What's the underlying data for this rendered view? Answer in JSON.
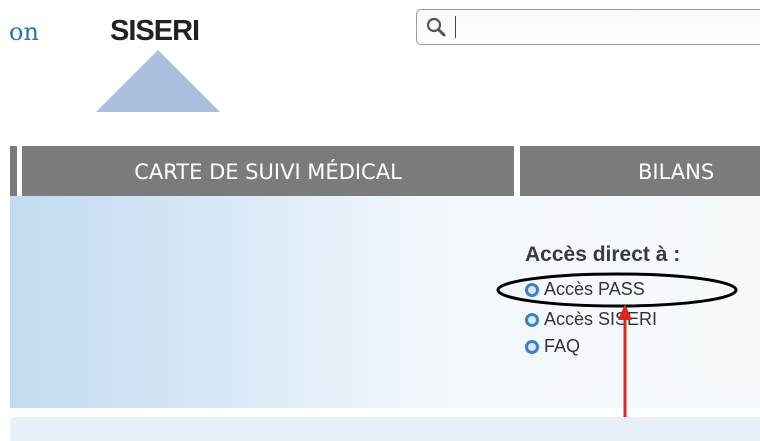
{
  "header": {
    "brand_fragment": "on",
    "logo_text": "SISERI",
    "logo_color": "#a9bfde",
    "search": {
      "value": "",
      "placeholder": ""
    }
  },
  "nav": {
    "items": [
      {
        "label": "CARTE DE SUIVI MÉDICAL"
      },
      {
        "label": "BILANS"
      }
    ],
    "bar_color": "#7b7b7b"
  },
  "direct_access": {
    "title": "Accès direct à :",
    "links": [
      {
        "label": "Accès PASS"
      },
      {
        "label": "Accès SISERI"
      },
      {
        "label": "FAQ"
      }
    ]
  },
  "annotation": {
    "arrow_color": "#e0251b",
    "highlight_target": "Accès PASS"
  }
}
